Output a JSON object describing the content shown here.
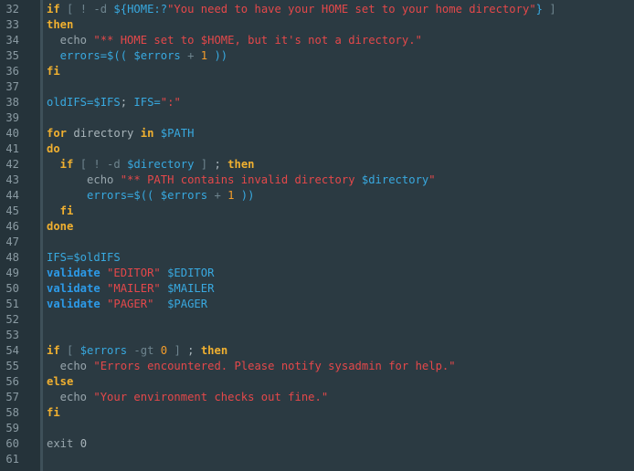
{
  "theme": {
    "background": "#2b3a42",
    "gutter": "#25333a",
    "keyword": "#f0b030",
    "string": "#e4484a",
    "variable": "#38a9e0",
    "number": "#f39c2a",
    "function": "#2c9ae8",
    "plain": "#a8b4ba"
  },
  "lines": [
    {
      "n": "32",
      "tokens": [
        [
          "kw",
          "if"
        ],
        [
          "op",
          " [ ! -d "
        ],
        [
          "var",
          "${HOME:?"
        ],
        [
          "str",
          "\"You need to have your HOME set to your home directory\""
        ],
        [
          "var",
          "}"
        ],
        [
          "op",
          " ]"
        ]
      ]
    },
    {
      "n": "33",
      "tokens": [
        [
          "kw",
          "then"
        ]
      ]
    },
    {
      "n": "34",
      "tokens": [
        [
          "cmd",
          "  echo "
        ],
        [
          "str",
          "\"** HOME set to $HOME, but it's not a directory.\""
        ]
      ]
    },
    {
      "n": "35",
      "tokens": [
        [
          "var",
          "  errors=$(( $errors "
        ],
        [
          "op",
          "+ "
        ],
        [
          "num",
          "1"
        ],
        [
          "var",
          " ))"
        ]
      ]
    },
    {
      "n": "36",
      "tokens": [
        [
          "kw",
          "fi"
        ]
      ]
    },
    {
      "n": "37",
      "tokens": []
    },
    {
      "n": "38",
      "tokens": [
        [
          "var",
          "oldIFS=$IFS"
        ],
        [
          "plain",
          "; "
        ],
        [
          "var",
          "IFS="
        ],
        [
          "str",
          "\":\""
        ]
      ]
    },
    {
      "n": "39",
      "tokens": []
    },
    {
      "n": "40",
      "tokens": [
        [
          "kw",
          "for"
        ],
        [
          "plain",
          " directory "
        ],
        [
          "kw",
          "in"
        ],
        [
          "var",
          " $PATH"
        ]
      ]
    },
    {
      "n": "41",
      "tokens": [
        [
          "kw",
          "do"
        ]
      ]
    },
    {
      "n": "42",
      "tokens": [
        [
          "kw",
          "  if"
        ],
        [
          "op",
          " [ ! -d "
        ],
        [
          "var",
          "$directory"
        ],
        [
          "op",
          " ] "
        ],
        [
          "plain",
          "; "
        ],
        [
          "kw",
          "then"
        ]
      ]
    },
    {
      "n": "43",
      "tokens": [
        [
          "cmd",
          "      echo "
        ],
        [
          "str",
          "\"** PATH contains invalid directory "
        ],
        [
          "var",
          "$directory"
        ],
        [
          "str",
          "\""
        ]
      ]
    },
    {
      "n": "44",
      "tokens": [
        [
          "var",
          "      errors=$(( $errors "
        ],
        [
          "op",
          "+ "
        ],
        [
          "num",
          "1"
        ],
        [
          "var",
          " ))"
        ]
      ]
    },
    {
      "n": "45",
      "tokens": [
        [
          "kw",
          "  fi"
        ]
      ]
    },
    {
      "n": "46",
      "tokens": [
        [
          "kw",
          "done"
        ]
      ]
    },
    {
      "n": "47",
      "tokens": []
    },
    {
      "n": "48",
      "tokens": [
        [
          "var",
          "IFS=$oldIFS"
        ]
      ]
    },
    {
      "n": "49",
      "tokens": [
        [
          "fn",
          "validate"
        ],
        [
          "str",
          " \"EDITOR\""
        ],
        [
          "var",
          " $EDITOR"
        ]
      ]
    },
    {
      "n": "50",
      "tokens": [
        [
          "fn",
          "validate"
        ],
        [
          "str",
          " \"MAILER\""
        ],
        [
          "var",
          " $MAILER"
        ]
      ]
    },
    {
      "n": "51",
      "tokens": [
        [
          "fn",
          "validate"
        ],
        [
          "str",
          " \"PAGER\""
        ],
        [
          "var",
          "  $PAGER"
        ]
      ]
    },
    {
      "n": "52",
      "tokens": []
    },
    {
      "n": "53",
      "tokens": []
    },
    {
      "n": "54",
      "tokens": [
        [
          "kw",
          "if"
        ],
        [
          "op",
          " [ "
        ],
        [
          "var",
          "$errors"
        ],
        [
          "op",
          " -gt "
        ],
        [
          "num",
          "0"
        ],
        [
          "op",
          " ] "
        ],
        [
          "plain",
          "; "
        ],
        [
          "kw",
          "then"
        ]
      ]
    },
    {
      "n": "55",
      "tokens": [
        [
          "cmd",
          "  echo "
        ],
        [
          "str",
          "\"Errors encountered. Please notify sysadmin for help.\""
        ]
      ]
    },
    {
      "n": "56",
      "tokens": [
        [
          "kw",
          "else"
        ]
      ]
    },
    {
      "n": "57",
      "tokens": [
        [
          "cmd",
          "  echo "
        ],
        [
          "str",
          "\"Your environment checks out fine.\""
        ]
      ]
    },
    {
      "n": "58",
      "tokens": [
        [
          "kw",
          "fi"
        ]
      ]
    },
    {
      "n": "59",
      "tokens": []
    },
    {
      "n": "60",
      "tokens": [
        [
          "cmd",
          "exit "
        ],
        [
          "plain",
          "0"
        ]
      ]
    },
    {
      "n": "61",
      "tokens": []
    }
  ]
}
